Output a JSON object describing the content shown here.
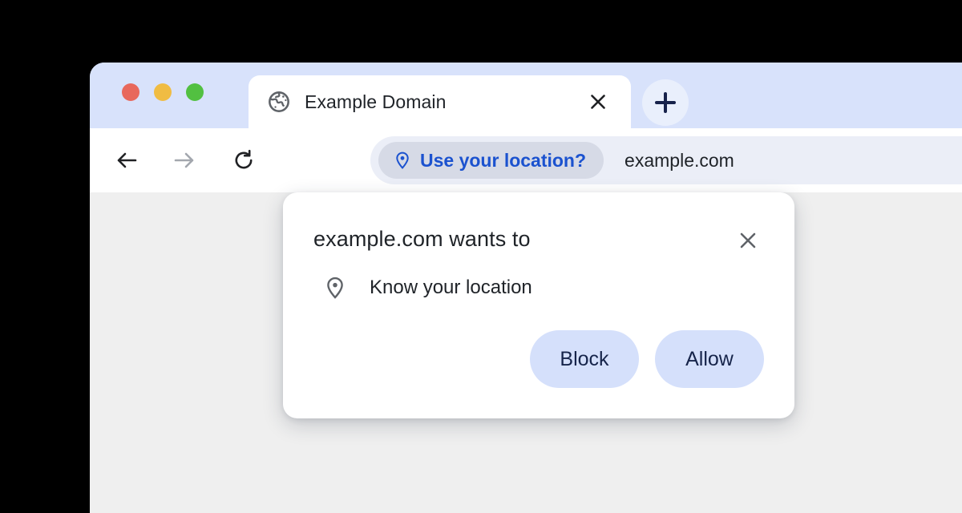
{
  "window": {
    "traffic_lights": [
      {
        "name": "close",
        "color": "#e8685c"
      },
      {
        "name": "minimize",
        "color": "#f0bc43"
      },
      {
        "name": "maximize",
        "color": "#52c041"
      }
    ]
  },
  "tab_strip": {
    "background_color": "#d8e2fb",
    "active_tab": {
      "title": "Example Domain",
      "favicon": "globe-icon",
      "close_icon": "close-icon"
    },
    "new_tab": {
      "icon": "plus-icon",
      "label": "+"
    }
  },
  "toolbar": {
    "back": {
      "icon": "arrow-left-icon",
      "enabled": true
    },
    "forward": {
      "icon": "arrow-right-icon",
      "enabled": false
    },
    "reload": {
      "icon": "reload-icon",
      "enabled": true
    },
    "omnibox": {
      "location_chip": {
        "icon": "location-pin-icon",
        "label": "Use your location?",
        "text_color": "#1b52cf",
        "background_color": "#d6dae6"
      },
      "url": "example.com"
    }
  },
  "permission_dialog": {
    "title": "example.com wants to",
    "close_icon": "close-icon",
    "permission": {
      "icon": "location-pin-outline-icon",
      "label": "Know your location"
    },
    "buttons": {
      "block": "Block",
      "allow": "Allow"
    },
    "button_background_color": "#d5e0fb",
    "button_text_color": "#16244a"
  },
  "page": {
    "background_color": "#efefef"
  }
}
